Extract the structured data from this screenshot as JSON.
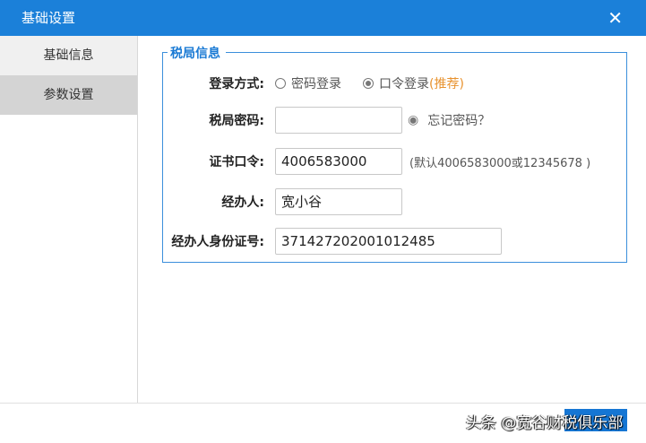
{
  "window": {
    "title": "基础设置",
    "close_icon": "close-icon"
  },
  "sidebar": {
    "items": [
      {
        "label": "基础信息"
      },
      {
        "label": "参数设置"
      }
    ]
  },
  "section": {
    "title": "税局信息"
  },
  "form": {
    "login_method": {
      "label": "登录方式:",
      "options": [
        "密码登录",
        "口令登录"
      ],
      "selected": 1,
      "recommend": "(推荐)"
    },
    "password": {
      "label": "税局密码:",
      "value": "",
      "forgot": "忘记密码？"
    },
    "cert": {
      "label": "证书口令:",
      "value": "4006583000",
      "hint": "(默认4006583000或12345678 )"
    },
    "agent": {
      "label": "经办人:",
      "value": "宽小谷"
    },
    "id": {
      "label": "经办人身份证号:",
      "value": "371427202001012485"
    }
  },
  "watermark": "头条 @宽谷财税俱乐部"
}
